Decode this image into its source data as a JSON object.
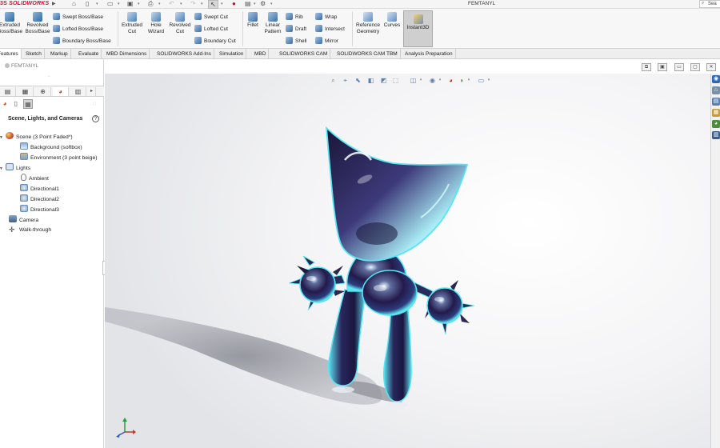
{
  "app": {
    "brand": "SOLIDWORKS",
    "brand_mark": "3S",
    "document_title": "FEMTANYL",
    "search_label": "Sea"
  },
  "quick_access": {
    "icons": [
      "home-icon",
      "new-document-icon",
      "open-icon",
      "save-icon",
      "print-icon",
      "undo-icon",
      "redo-icon",
      "select-icon",
      "rebuild-icon",
      "file-properties-icon",
      "options-icon"
    ]
  },
  "ribbon": {
    "extruded_boss": "Extruded Boss/Base",
    "revolved_boss": "Revolved Boss/Base",
    "swept_boss": "Swept Boss/Base",
    "lofted_boss": "Lofted Boss/Base",
    "boundary_boss": "Boundary Boss/Base",
    "extruded_cut": "Extruded Cut",
    "hole_wizard": "Hole Wizard",
    "revolved_cut": "Revolved Cut",
    "swept_cut": "Swept Cut",
    "lofted_cut": "Lofted Cut",
    "boundary_cut": "Boundary Cut",
    "fillet": "Fillet",
    "linear_pattern": "Linear Pattern",
    "rib": "Rib",
    "draft": "Draft",
    "shell": "Shell",
    "wrap": "Wrap",
    "intersect": "Intersect",
    "mirror": "Mirror",
    "reference_geometry": "Reference Geometry",
    "curves": "Curves",
    "instant3d": "Instant3D"
  },
  "tabs": [
    "Features",
    "Sketch",
    "Markup",
    "Evaluate",
    "MBD Dimensions",
    "SOLIDWORKS Add-Ins",
    "Simulation",
    "MBD",
    "SOLIDWORKS CAM",
    "SOLIDWORKS CAM TBM",
    "Analysis Preparation"
  ],
  "active_tab": "Features",
  "left_pane": {
    "doc_tab": "FEMTANYL",
    "panel_title": "Scene, Lights, and Cameras",
    "help": "?",
    "tree": {
      "scene": "Scene (3 Point Faded*)",
      "background": "Background (softbox)",
      "environment": "Environment (3 point beige)",
      "lights": "Lights",
      "ambient": "Ambient",
      "directional1": "Directional1",
      "directional2": "Directional2",
      "directional3": "Directional3",
      "camera": "Camera",
      "walkthrough": "Walk-through"
    }
  },
  "colors": {
    "accent_red": "#c8102e",
    "model_rim": "#3fe0f0",
    "model_body": "#1d1740",
    "shadow": "#8a8c96"
  }
}
